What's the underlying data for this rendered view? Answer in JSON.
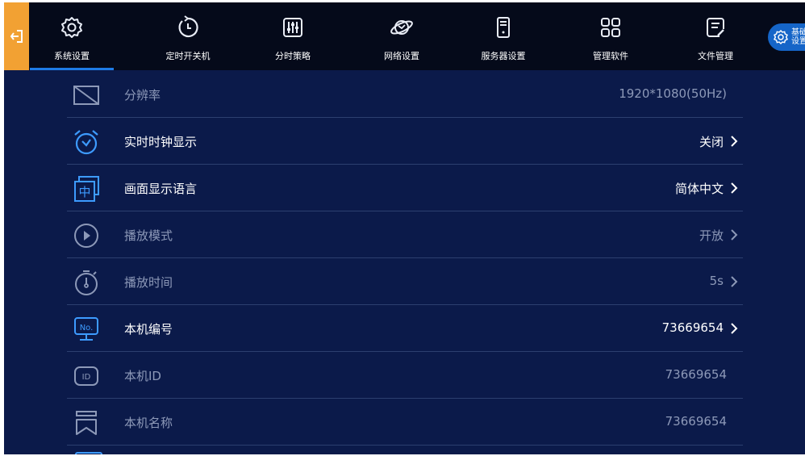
{
  "nav": {
    "tabs": [
      {
        "label": "系统设置",
        "icon": "gear-icon",
        "active": true
      },
      {
        "label": "定时开关机",
        "icon": "timer-power-icon"
      },
      {
        "label": "分时策略",
        "icon": "sliders-icon"
      },
      {
        "label": "网络设置",
        "icon": "planet-network-icon"
      },
      {
        "label": "服务器设置",
        "icon": "server-icon"
      },
      {
        "label": "管理软件",
        "icon": "apps-grid-icon"
      },
      {
        "label": "文件管理",
        "icon": "file-edit-icon"
      }
    ],
    "side_button": {
      "label_line1": "基础",
      "label_line2": "设置"
    }
  },
  "settings": [
    {
      "label": "分辨率",
      "value": "1920*1080(50Hz)",
      "icon": "monitor-icon",
      "enabled": false,
      "chevron": false
    },
    {
      "label": "实时时钟显示",
      "value": "关闭",
      "icon": "alarm-clock-icon",
      "enabled": true,
      "chevron": true
    },
    {
      "label": "画面显示语言",
      "value": "简体中文",
      "icon": "language-icon",
      "enabled": true,
      "chevron": true
    },
    {
      "label": "播放模式",
      "value": "开放",
      "icon": "play-circle-icon",
      "enabled": false,
      "chevron": true
    },
    {
      "label": "播放时间",
      "value": "5s",
      "icon": "stopwatch-icon",
      "enabled": false,
      "chevron": true
    },
    {
      "label": "本机编号",
      "value": "73669654",
      "icon": "device-number-icon",
      "enabled": true,
      "chevron": true
    },
    {
      "label": "本机ID",
      "value": "73669654",
      "icon": "id-badge-icon",
      "enabled": false,
      "chevron": false
    },
    {
      "label": "本机名称",
      "value": "73669654",
      "icon": "bookmark-name-icon",
      "enabled": false,
      "chevron": false
    }
  ],
  "colors": {
    "background": "#0b1a4a",
    "topbar": "#050a1a",
    "accent_orange": "#f2a133",
    "accent_blue": "#1e7be6",
    "icon_blue": "#3d9bff"
  },
  "icon_glyphs": {
    "language_char": "中",
    "number_text": "No.",
    "id_text": "ID"
  }
}
